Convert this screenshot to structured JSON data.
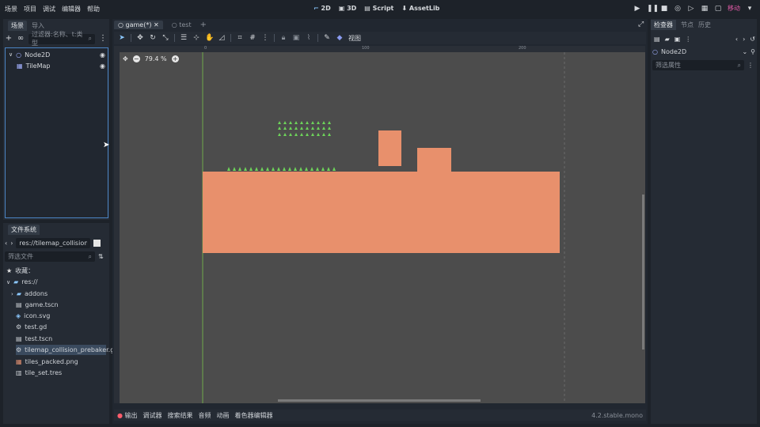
{
  "menu": [
    "场景",
    "项目",
    "调试",
    "编辑器",
    "帮助"
  ],
  "modes": {
    "d2": "2D",
    "d3": "3D",
    "script": "Script",
    "assetlib": "AssetLib"
  },
  "run_mode_label": "移动",
  "scene_dock": {
    "tabs": [
      "场景",
      "导入"
    ],
    "filter_placeholder": "过滤器:名称、t:类型",
    "nodes": [
      {
        "name": "Node2D"
      },
      {
        "name": "TileMap"
      }
    ]
  },
  "filesystem": {
    "tab": "文件系统",
    "path": "res://tilemap_collision_preb",
    "filter_placeholder": "筛选文件",
    "favorites": "收藏：",
    "items": [
      {
        "name": "res://",
        "icon": "folder-icon"
      },
      {
        "name": "addons",
        "icon": "folder-icon"
      },
      {
        "name": "game.tscn",
        "icon": "scene-icon"
      },
      {
        "name": "icon.svg",
        "icon": "image-icon"
      },
      {
        "name": "test.gd",
        "icon": "gear-icon"
      },
      {
        "name": "test.tscn",
        "icon": "scene-icon"
      },
      {
        "name": "tilemap_collision_prebaker.gd",
        "icon": "gear-icon"
      },
      {
        "name": "tiles_packed.png",
        "icon": "image-icon"
      },
      {
        "name": "tile_set.tres",
        "icon": "resource-icon"
      }
    ]
  },
  "viewport": {
    "tabs": [
      "game(*)",
      "test"
    ],
    "view_menu": "视图",
    "zoom": "79.4 %",
    "ruler_marks": [
      "0",
      "100",
      "200"
    ]
  },
  "bottom_tabs": [
    "输出",
    "调试器",
    "搜索结果",
    "音频",
    "动画",
    "着色器编辑器"
  ],
  "version": "4.2.stable.mono",
  "inspector": {
    "tabs": [
      "检查器",
      "节点",
      "历史"
    ],
    "node": "Node2D",
    "filter_placeholder": "筛选属性"
  },
  "colors": {
    "tile": "#e8906c",
    "grass": "#6dd35a",
    "canvas": "#4c4c4c",
    "accent": "#8cc8ff"
  }
}
